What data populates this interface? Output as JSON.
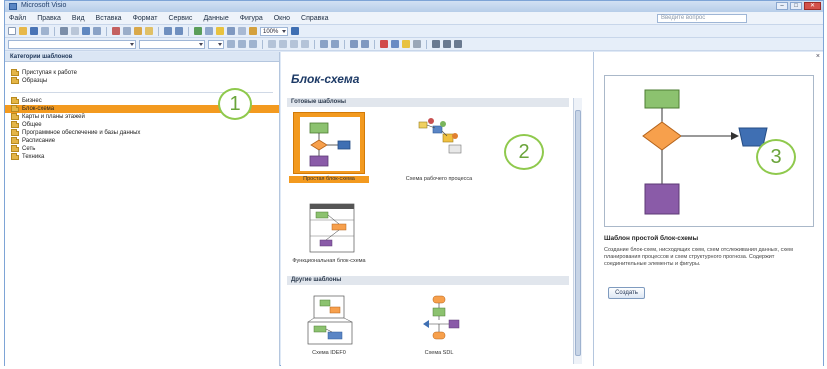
{
  "window": {
    "title": "Microsoft Visio",
    "minimize": "–",
    "maximize": "□",
    "close": "✕"
  },
  "menu": [
    "Файл",
    "Правка",
    "Вид",
    "Вставка",
    "Формат",
    "Сервис",
    "Данные",
    "Фигура",
    "Окно",
    "Справка"
  ],
  "help_search_placeholder": "Введите вопрос",
  "toolbar": {
    "zoom": "100%"
  },
  "left_pane": {
    "header": "Категории шаблонов",
    "top_group": [
      "Приступая к работе",
      "Образцы"
    ],
    "categories": [
      "Бизнес",
      "Блок-схема",
      "Карты и планы этажей",
      "Общее",
      "Программное обеспечение и базы данных",
      "Расписание",
      "Сеть",
      "Техника"
    ],
    "selected_index": 1
  },
  "middle_pane": {
    "title": "Блок-схема",
    "section_featured": "Готовые шаблоны",
    "section_other": "Другие шаблоны",
    "tiles": [
      {
        "label": "Простая блок-схема",
        "selected": true
      },
      {
        "label": "Схема рабочего процесса",
        "selected": false
      },
      {
        "label": "Функциональная блок-схема",
        "selected": false
      }
    ],
    "other_tiles": [
      {
        "label": "Схема IDEF0"
      },
      {
        "label": "Схема SDL"
      }
    ]
  },
  "right_pane": {
    "preview_title": "Шаблон простой блок-схемы",
    "description": "Создание блок-схем, нисходящих схем, схем отслеживания данных, схем планирования процессов и схем структурного прогноза. Содержит соединительные элементы и фигуры.",
    "create_button": "Создать",
    "close": "×"
  },
  "callouts": [
    "1",
    "2",
    "3"
  ],
  "colors": {
    "selection": "#f39a1f",
    "process_green": "#8cc26f",
    "decision_orange": "#f7a04c",
    "data_blue": "#3f6fb3",
    "terminal_purple": "#8a5ba8",
    "callout_green": "#8fc94d"
  }
}
